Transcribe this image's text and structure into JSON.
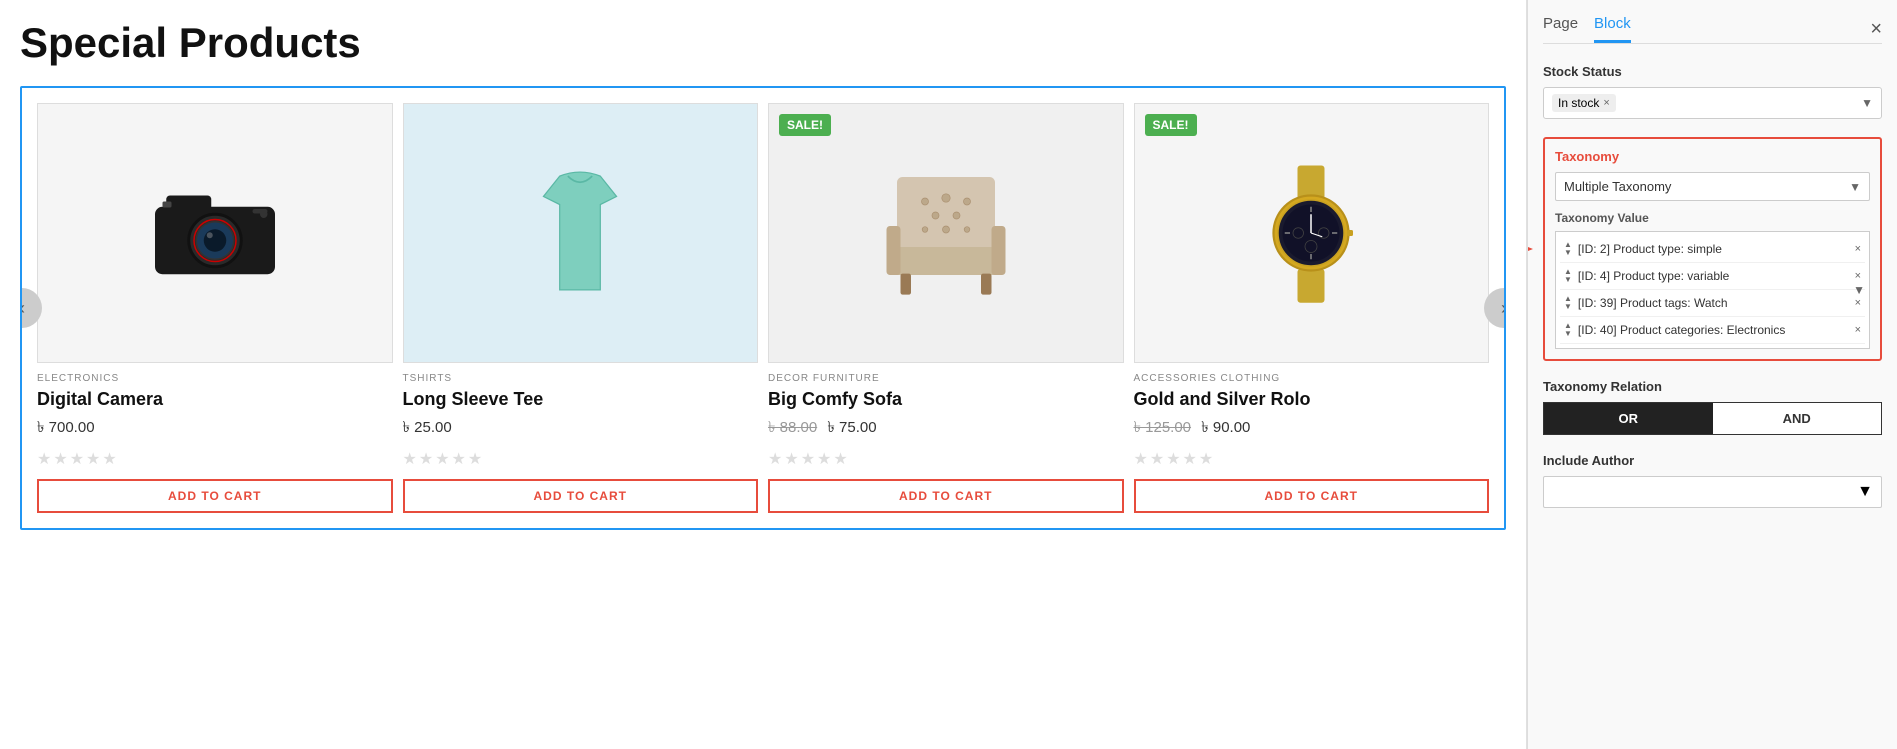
{
  "page": {
    "title": "Special Products"
  },
  "sidebar": {
    "tab_page": "Page",
    "tab_block": "Block",
    "active_tab": "Block",
    "close_label": "×",
    "stock_status": {
      "label": "Stock Status",
      "value": "In stock",
      "remove_x": "×",
      "arrow": "▼"
    },
    "taxonomy": {
      "label": "Taxonomy",
      "select_value": "Multiple Taxonomy",
      "arrow": "▼",
      "value_label": "Taxonomy Value",
      "items": [
        {
          "id": "[ID: 2] Product type: simple",
          "remove": "×"
        },
        {
          "id": "[ID: 4] Product type: variable",
          "remove": "×"
        },
        {
          "id": "[ID: 39] Product tags: Watch",
          "remove": "×"
        },
        {
          "id": "[ID: 40] Product categories: Electronics",
          "remove": "×"
        }
      ],
      "dropdown_arrow": "▼"
    },
    "taxonomy_relation": {
      "label": "Taxonomy Relation",
      "or_label": "OR",
      "and_label": "AND",
      "active": "OR"
    },
    "include_author": {
      "label": "Include Author",
      "placeholder": "",
      "arrow": "▼"
    }
  },
  "products": [
    {
      "id": "camera",
      "category": "ELECTRONICS",
      "name": "Digital Camera",
      "price": "700.00",
      "currency": "৳",
      "old_price": null,
      "sale": false,
      "add_to_cart": "ADD TO CART"
    },
    {
      "id": "shirt",
      "category": "TSHIRTS",
      "name": "Long Sleeve Tee",
      "price": "25.00",
      "currency": "৳",
      "old_price": null,
      "sale": false,
      "add_to_cart": "ADD TO CART"
    },
    {
      "id": "sofa",
      "category": "DECOR FURNITURE",
      "name": "Big Comfy Sofa",
      "price": "75.00",
      "currency": "৳",
      "old_price": "88.00",
      "sale": true,
      "sale_label": "SALE!",
      "add_to_cart": "ADD TO CART"
    },
    {
      "id": "watch",
      "category": "ACCESSORIES CLOTHING",
      "name": "Gold and Silver Rolo",
      "price": "90.00",
      "currency": "৳",
      "old_price": "125.00",
      "sale": true,
      "sale_label": "SALE!",
      "add_to_cart": "ADD TO CART"
    }
  ]
}
